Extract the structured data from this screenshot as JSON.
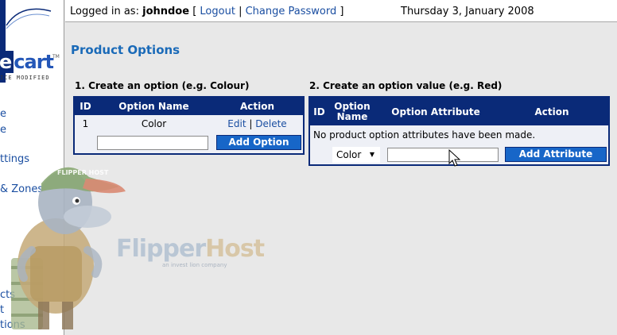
{
  "header": {
    "logged_in_label": "Logged in as:",
    "username": "johndoe",
    "bracket_open": "[",
    "logout": "Logout",
    "separator": "|",
    "change_password": "Change Password",
    "bracket_close": "]",
    "date": "Thursday 3, January 2008"
  },
  "sidebar": {
    "logo_text_dark": "e",
    "logo_text_light": "cart",
    "logo_tm": "TM",
    "logo_sub": "ICE MODIFIED",
    "items": [
      {
        "label": "e"
      },
      {
        "label": "e"
      },
      {
        "label": "ttings"
      },
      {
        "label": "& Zones"
      },
      {
        "label": "cts"
      },
      {
        "label": "t"
      },
      {
        "label": "tions"
      }
    ]
  },
  "page_title": "Product Options",
  "watermark": {
    "flipper": "Flipper",
    "host": "Host",
    "sub": "an invest lion company",
    "cap": "FLIPPER HOST"
  },
  "section1": {
    "title": "1. Create an option (e.g. Colour)",
    "headers": {
      "id": "ID",
      "name": "Option Name",
      "action": "Action"
    },
    "rows": [
      {
        "id": "1",
        "name": "Color",
        "edit": "Edit",
        "sep": "|",
        "delete": "Delete"
      }
    ],
    "input_value": "",
    "add_button": "Add Option"
  },
  "section2": {
    "title": "2. Create an option value (e.g. Red)",
    "headers": {
      "id": "ID",
      "name_line1": "Option",
      "name_line2": "Name",
      "attribute": "Option Attribute",
      "action": "Action"
    },
    "empty_message": "No product option attributes have been made.",
    "select_value": "Color",
    "input_value": "",
    "add_button": "Add Attribute"
  },
  "colors": {
    "table_header": "#0a2a78",
    "button": "#1766c8",
    "link": "#1a4ea1",
    "title": "#1a6ab8"
  }
}
